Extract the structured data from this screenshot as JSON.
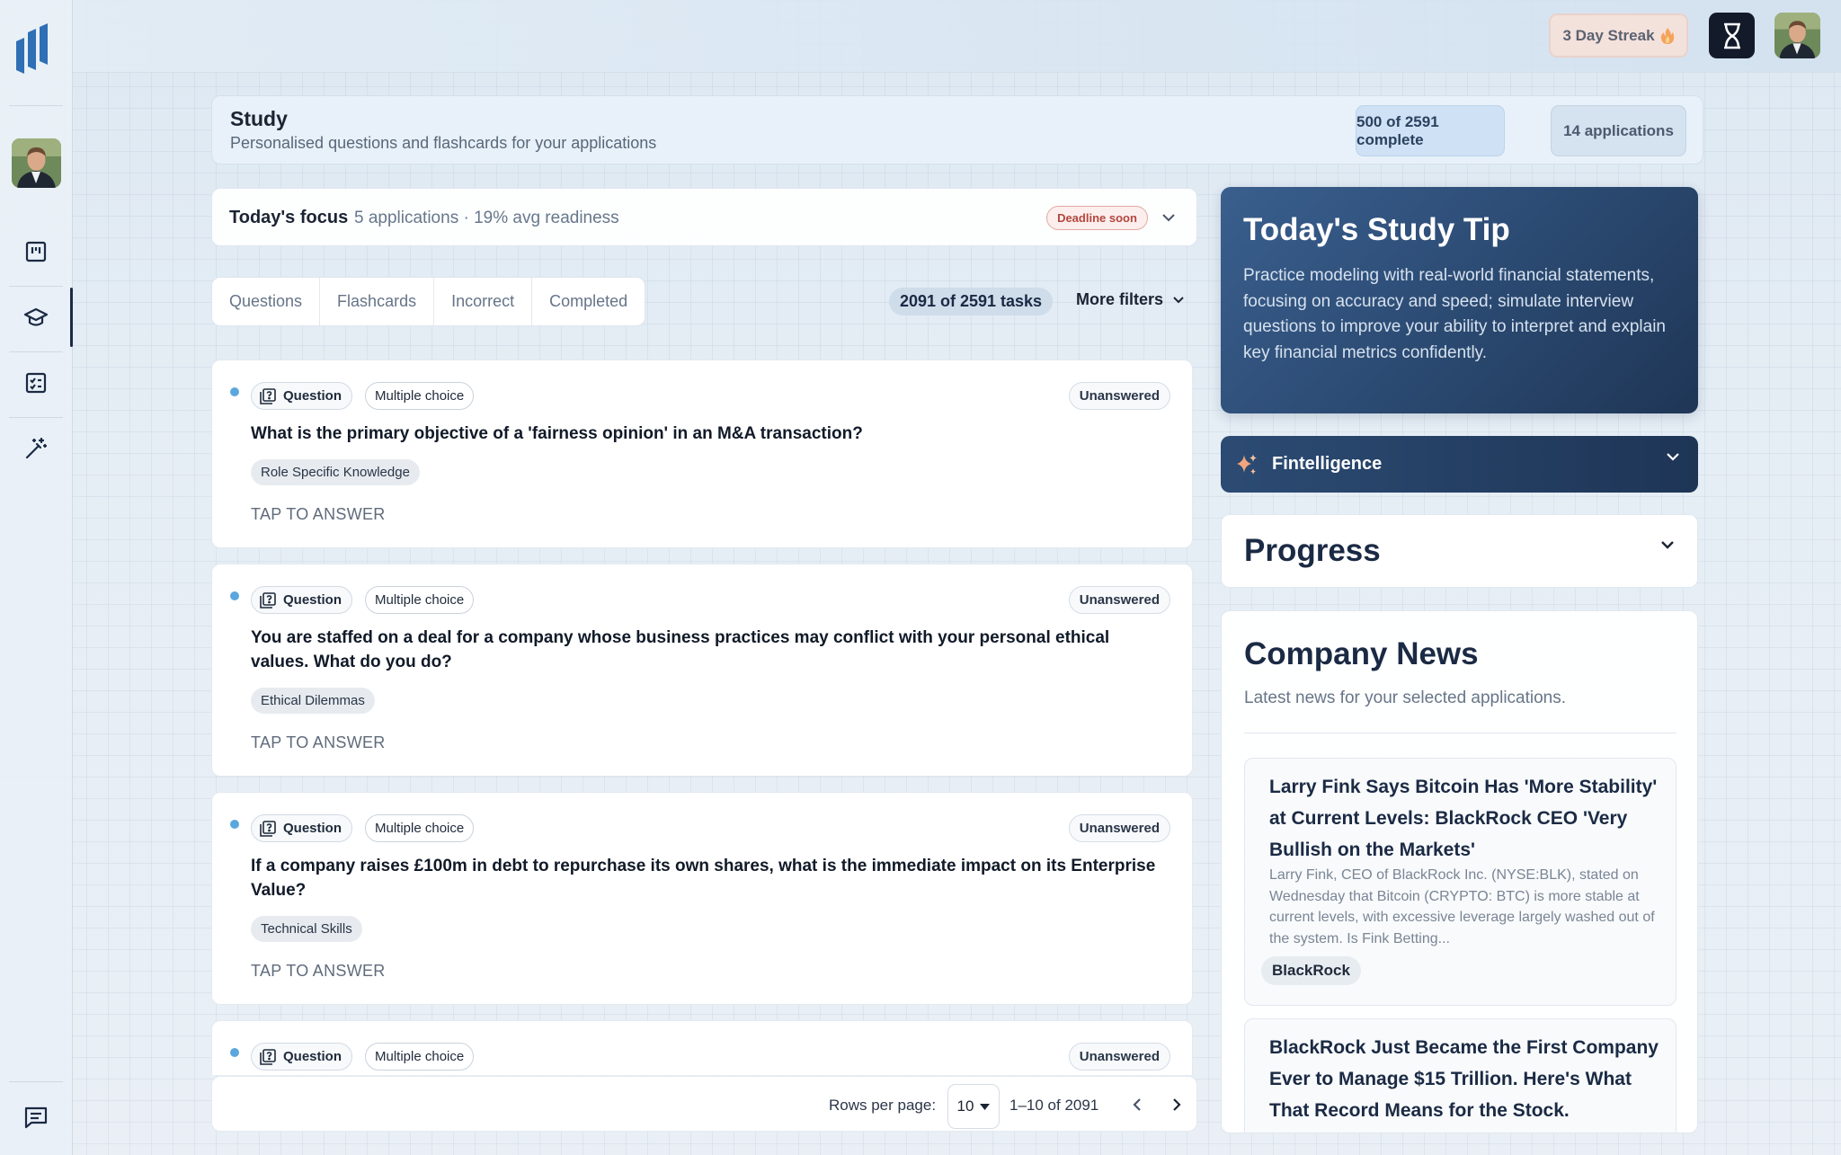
{
  "topbar": {
    "streak_label": "3 Day Streak"
  },
  "header": {
    "title": "Study",
    "subtitle": "Personalised questions and flashcards for your applications",
    "complete_label": "500 of 2591 complete",
    "applications_label": "14 applications"
  },
  "focus": {
    "title": "Today's focus",
    "subtitle": "5 applications · 19% avg readiness",
    "badge": "Deadline soon"
  },
  "tabs": [
    {
      "label": "Questions"
    },
    {
      "label": "Flashcards"
    },
    {
      "label": "Incorrect"
    },
    {
      "label": "Completed"
    }
  ],
  "filters": {
    "tasks_label": "2091 of 2591 tasks",
    "more_label": "More filters"
  },
  "questions": [
    {
      "kind": "Question",
      "type": "Multiple choice",
      "status": "Unanswered",
      "text": "What is the primary objective of a 'fairness opinion' in an M&A transaction?",
      "category": "Role Specific Knowledge",
      "action": "TAP TO ANSWER"
    },
    {
      "kind": "Question",
      "type": "Multiple choice",
      "status": "Unanswered",
      "text": "You are staffed on a deal for a company whose business practices may conflict with your personal ethical values. What do you do?",
      "category": "Ethical Dilemmas",
      "action": "TAP TO ANSWER"
    },
    {
      "kind": "Question",
      "type": "Multiple choice",
      "status": "Unanswered",
      "text": "If a company raises £100m in debt to repurchase its own shares, what is the immediate impact on its Enterprise Value?",
      "category": "Technical Skills",
      "action": "TAP TO ANSWER"
    },
    {
      "kind": "Question",
      "type": "Multiple choice",
      "status": "Unanswered"
    }
  ],
  "pagination": {
    "rows_label": "Rows per page:",
    "rows_value": "10",
    "range_label": "1–10 of 2091"
  },
  "tip": {
    "title": "Today's Study Tip",
    "body": "Practice modeling with real-world financial statements, focusing on accuracy and speed; simulate interview questions to improve your ability to interpret and explain key financial metrics confidently."
  },
  "fintelligence": {
    "label": "Fintelligence"
  },
  "progress": {
    "title": "Progress"
  },
  "news": {
    "title": "Company News",
    "subtitle": "Latest news for your selected applications.",
    "articles": [
      {
        "title": "Larry Fink Says Bitcoin Has 'More Stability' at Current Levels: BlackRock CEO 'Very Bullish on the Markets'",
        "body": "Larry Fink, CEO of BlackRock Inc. (NYSE:BLK), stated on Wednesday that Bitcoin (CRYPTO: BTC) is more stable at current levels, with excessive leverage largely washed out of the system. Is Fink Betting...",
        "tag": "BlackRock"
      },
      {
        "title": "BlackRock Just Became the First Company Ever to Manage $15 Trillion. Here's What That Record Means for the Stock.",
        "body": "",
        "tag": ""
      }
    ]
  },
  "colors": {
    "accent_dark": "#1b2a44",
    "tip_gradient": "#2d4d76",
    "deadline": "#b3463c",
    "unread_dot": "#5aa7dd"
  }
}
